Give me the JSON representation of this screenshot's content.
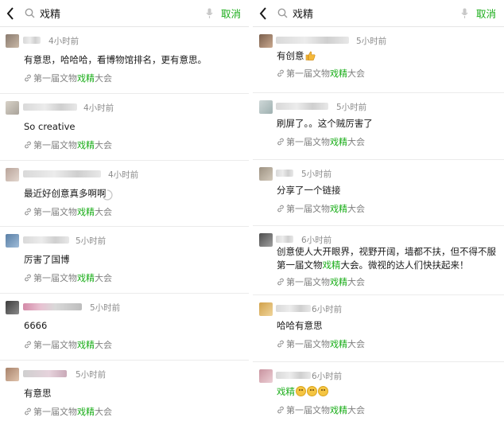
{
  "search": {
    "query": "戏精",
    "cancel_label": "取消"
  },
  "source_label": {
    "prefix": "第一届文物",
    "highlight": "戏精",
    "suffix": "大会"
  },
  "left": [
    {
      "time": "4小时前",
      "content": "有意思，哈哈哈，看博物馆排名，更有意思。"
    },
    {
      "time": "4小时前",
      "content": "So creative"
    },
    {
      "time": "4小时前",
      "content": "最近好创意真多啊啊"
    },
    {
      "time": "5小时前",
      "content": "厉害了国博"
    },
    {
      "time": "5小时前",
      "content": "6666"
    },
    {
      "time": "5小时前",
      "content": "有意思"
    }
  ],
  "right": [
    {
      "time": "5小时前",
      "content": "有创意"
    },
    {
      "time": "5小时前",
      "content": "刷屏了。。这个贼厉害了"
    },
    {
      "time": "5小时前",
      "content": "分享了一个链接"
    },
    {
      "time": "6小时前",
      "content_before": "创意使人大开眼界，视野开阔，墙都不扶，但不得不服第一届文物",
      "content_hl": "戏精",
      "content_after": "大会。微视的达人们快扶起来！"
    },
    {
      "time": "6小时前",
      "content": "哈哈有意思"
    },
    {
      "time": "6小时前",
      "content_hl": "戏精"
    }
  ],
  "colors": {
    "accent": "#1aad19",
    "muted": "#8c8c8c",
    "text": "#191919"
  }
}
